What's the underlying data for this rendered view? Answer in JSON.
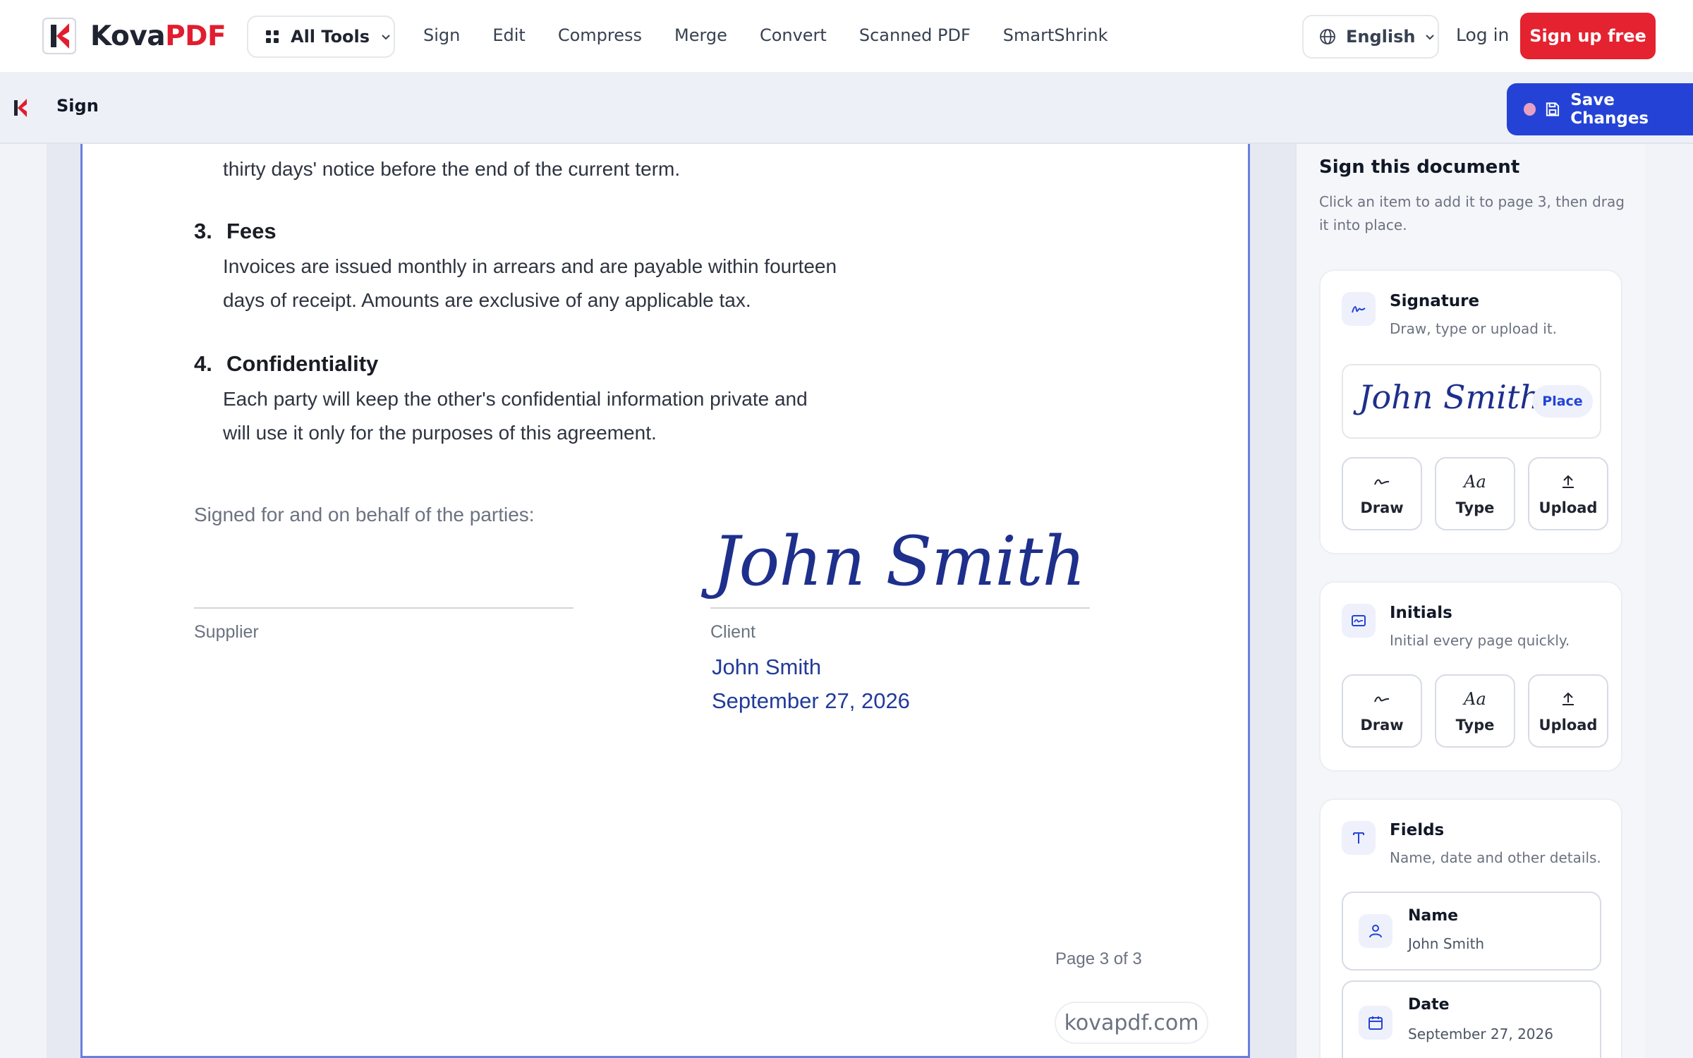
{
  "brand": {
    "name_main": "Kova",
    "name_accent": "PDF",
    "brand_color": "#e11d2e"
  },
  "nav": {
    "all_tools_label": "All Tools",
    "links": [
      "Sign",
      "Edit",
      "Compress",
      "Merge",
      "Convert",
      "Scanned PDF",
      "SmartShrink"
    ],
    "language": "English",
    "login": "Log in",
    "signup": "Sign up free"
  },
  "subbar": {
    "title": "Sign",
    "save_label": "Save Changes",
    "accent": "#2443d6"
  },
  "document": {
    "intro_line": "thirty days' notice before the end of the current term.",
    "sections": [
      {
        "number": "3.",
        "heading": "Fees",
        "lines": [
          "Invoices are issued monthly in arrears and are payable within fourteen",
          "days of receipt. Amounts are exclusive of any applicable tax."
        ]
      },
      {
        "number": "4.",
        "heading": "Confidentiality",
        "lines": [
          "Each party will keep the other's confidential information private and",
          "will use it only for the purposes of this agreement."
        ]
      }
    ],
    "signed_on_behalf": "Signed for and on behalf of the parties:",
    "supplier_label": "Supplier",
    "client_label": "Client",
    "signature_script": "John Smith",
    "signer_name": "John Smith",
    "signed_date": "September 27, 2026",
    "page_indicator": "Page 3 of 3",
    "watermark": "kovapdf.com"
  },
  "panel": {
    "title": "Sign this document",
    "description": "Click an item to add it to page 3, then drag it into place.",
    "signature_card": {
      "title": "Signature",
      "subtitle": "Draw, type or upload it.",
      "preview": "John Smith",
      "place_label": "Place",
      "options": [
        "Draw",
        "Type",
        "Upload"
      ]
    },
    "initials_card": {
      "title": "Initials",
      "subtitle": "Initial every page quickly.",
      "options": [
        "Draw",
        "Type",
        "Upload"
      ]
    },
    "fields_card": {
      "title": "Fields",
      "subtitle": "Name, date and other details.",
      "name_label": "Name",
      "name_value": "John Smith",
      "date_label": "Date",
      "date_value": "September 27, 2026"
    },
    "type_glyph": "Aa"
  }
}
